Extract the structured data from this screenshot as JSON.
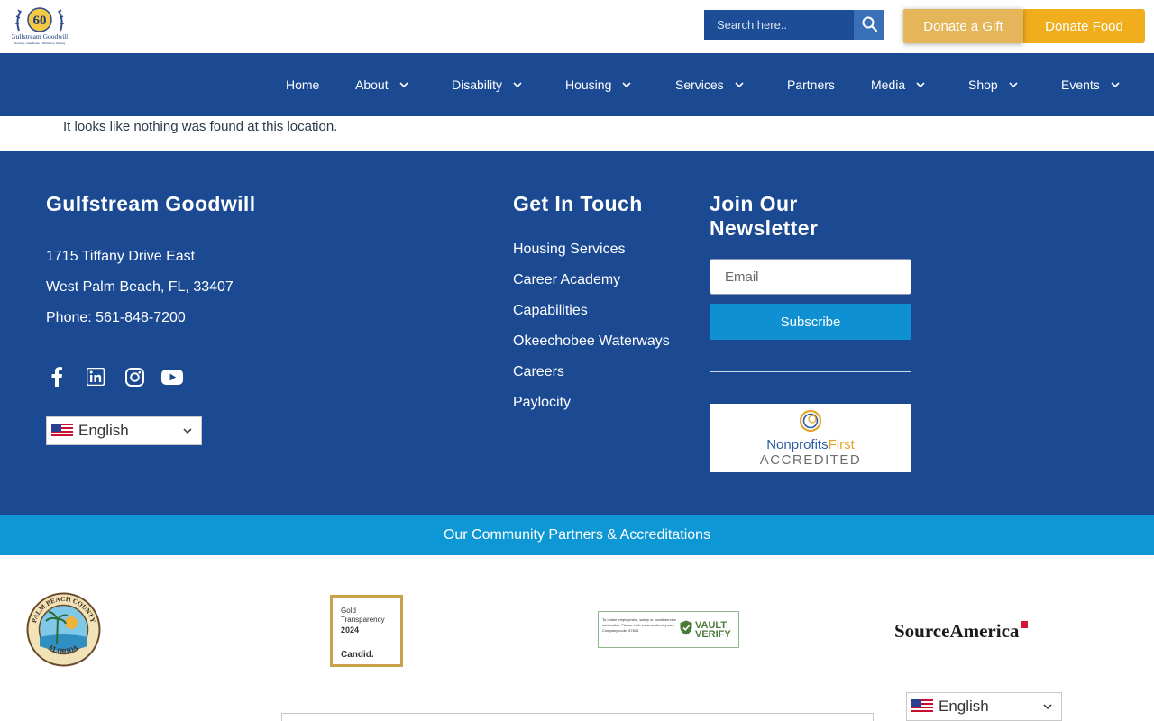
{
  "header": {
    "logo_text": "Gulfstream Goodwill",
    "logo_number": "60",
    "logo_tagline": "Housing • Healthcare • Workforce Training",
    "search_placeholder": "Search here..",
    "donate_gift_label": "Donate a Gift",
    "donate_food_label": "Donate Food",
    "colors": {
      "gift": "#e5b55a",
      "food": "#f0ae1d",
      "nav": "#1b4a93",
      "search": "#1c4d96"
    }
  },
  "nav": {
    "items": [
      {
        "label": "Home",
        "has_dropdown": false
      },
      {
        "label": "About",
        "has_dropdown": true
      },
      {
        "label": "Disability",
        "has_dropdown": true
      },
      {
        "label": "Housing",
        "has_dropdown": true
      },
      {
        "label": "Services",
        "has_dropdown": true
      },
      {
        "label": "Partners",
        "has_dropdown": false
      },
      {
        "label": "Media",
        "has_dropdown": true
      },
      {
        "label": "Shop",
        "has_dropdown": true
      },
      {
        "label": "Events",
        "has_dropdown": true
      }
    ]
  },
  "main": {
    "notice": "It looks like nothing was found at this location."
  },
  "footer": {
    "org_heading": "Gulfstream Goodwill",
    "address_line1": "1715 Tiffany Drive East",
    "address_line2": "West Palm Beach, FL, 33407",
    "phone": "Phone: 561-848-7200",
    "social_icons": [
      "facebook-icon",
      "linkedin-icon",
      "instagram-icon",
      "youtube-icon"
    ],
    "language": "English",
    "contact_heading": "Get In Touch",
    "links": [
      "Housing Services",
      "Career Academy",
      "Capabilities",
      "Okeechobee Waterways",
      "Careers",
      "Paylocity"
    ],
    "newsletter_heading": "Join Our Newsletter",
    "email_placeholder": "Email",
    "subscribe_label": "Subscribe",
    "badge": {
      "line1_a": "Nonprofits",
      "line1_b": "First",
      "line2": "ACCREDITED"
    },
    "colors": {
      "background": "#1b4a93",
      "subscribe": "#0e90d2"
    }
  },
  "partners": {
    "band_label": "Our Community Partners & Accreditations",
    "band_color": "#0e97d5",
    "pbc_top": "PALM BEACH COUNTY",
    "pbc_bottom": "FLORIDA",
    "candid_line1": "Gold",
    "candid_line2": "Transparency",
    "candid_year": "2024",
    "candid_brand": "Candid.",
    "vault_text": "To obtain employment, salary or social service verification. Please visit: www.vaultverify.com Company code: 57831",
    "vault_brand_1": "VAULT",
    "vault_brand_2": "VERIFY",
    "source_america": "SourceAmerica",
    "bottom_language": "English"
  }
}
